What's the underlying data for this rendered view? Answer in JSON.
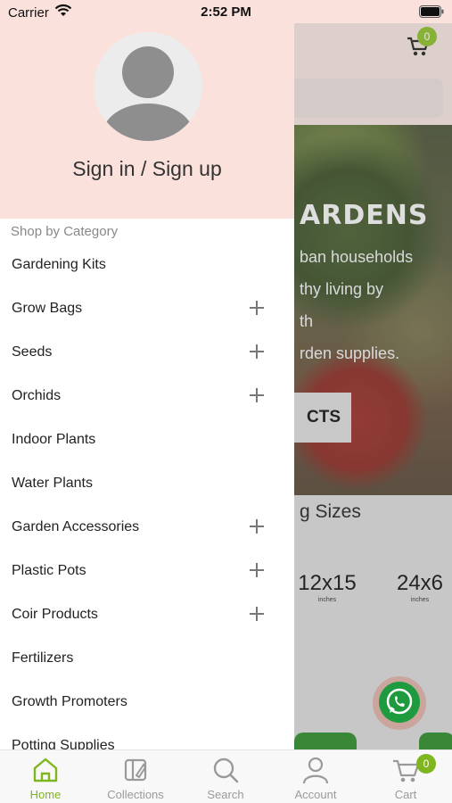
{
  "status_bar": {
    "carrier": "Carrier",
    "time": "2:52 PM"
  },
  "background": {
    "cart_count": "0",
    "hero_title": "ARDENS",
    "hero_lines": [
      "ban households",
      "thy living by",
      "th",
      "rden supplies."
    ],
    "hero_button": "CTS",
    "section_title": "g Sizes",
    "sizes": [
      {
        "size": "12x15",
        "unit": "inches"
      },
      {
        "size": "24x6",
        "unit": "inches"
      }
    ]
  },
  "drawer": {
    "sign_in_label": "Sign in / Sign up",
    "category_heading": "Shop by Category",
    "items": [
      {
        "label": "Gardening Kits",
        "expandable": false
      },
      {
        "label": "Grow Bags",
        "expandable": true
      },
      {
        "label": "Seeds",
        "expandable": true
      },
      {
        "label": "Orchids",
        "expandable": true
      },
      {
        "label": "Indoor Plants",
        "expandable": false
      },
      {
        "label": "Water Plants",
        "expandable": false
      },
      {
        "label": "Garden Accessories",
        "expandable": true
      },
      {
        "label": "Plastic Pots",
        "expandable": true
      },
      {
        "label": "Coir Products",
        "expandable": true
      },
      {
        "label": "Fertilizers",
        "expandable": false
      },
      {
        "label": "Growth Promoters",
        "expandable": false
      },
      {
        "label": "Potting Supplies",
        "expandable": false
      }
    ]
  },
  "tab_bar": {
    "active": "Home",
    "tabs": [
      {
        "label": "Home",
        "icon": "home-icon"
      },
      {
        "label": "Collections",
        "icon": "collections-icon"
      },
      {
        "label": "Search",
        "icon": "search-icon"
      },
      {
        "label": "Account",
        "icon": "account-icon"
      },
      {
        "label": "Cart",
        "icon": "cart-icon",
        "badge": "0"
      }
    ]
  },
  "colors": {
    "accent": "#7fb51f",
    "drawer_header": "#fbe1dc",
    "badge": "#8bbd2a"
  }
}
